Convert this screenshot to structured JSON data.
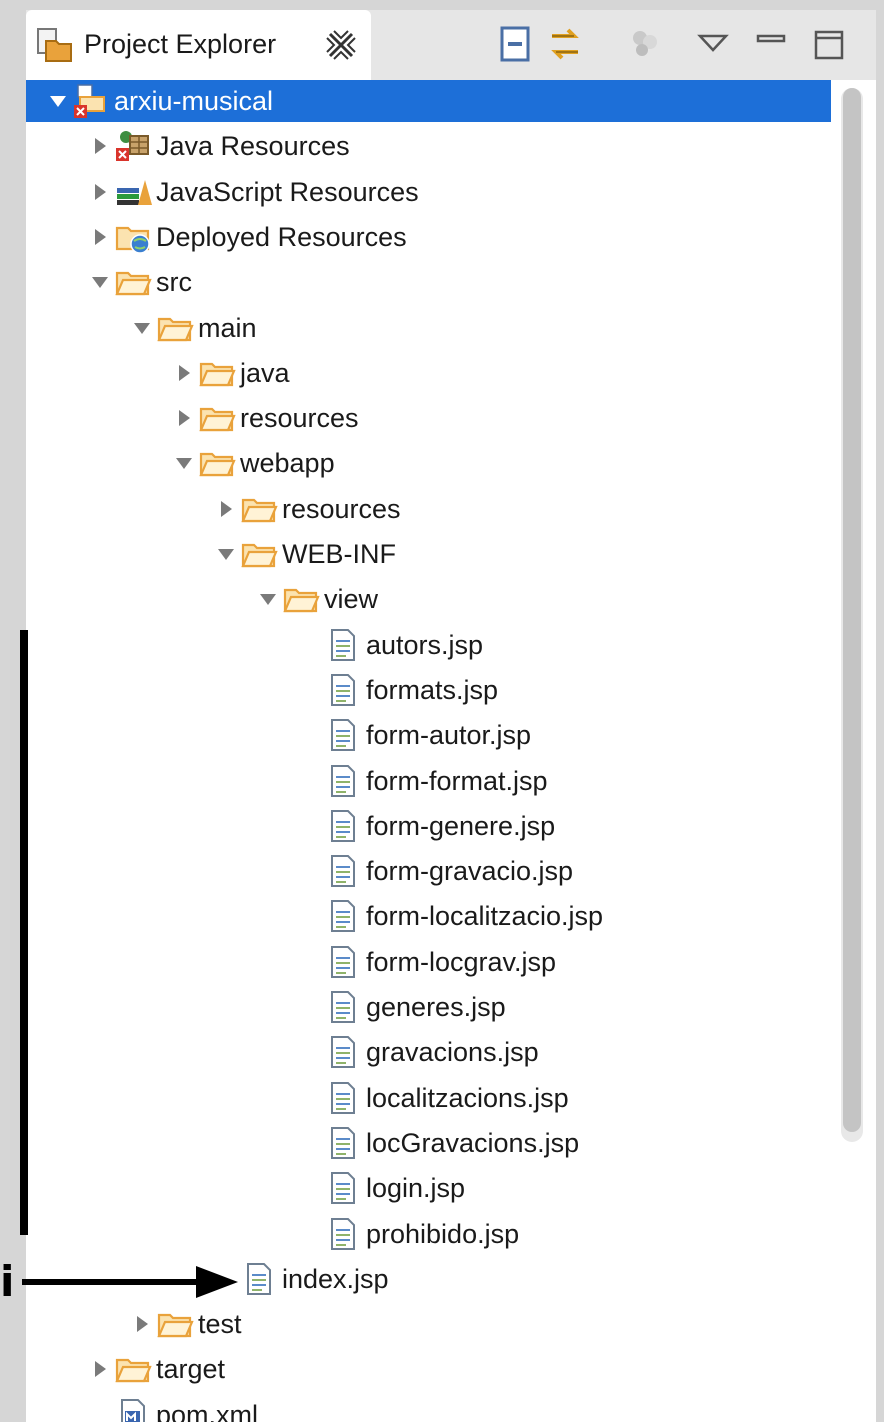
{
  "view": {
    "title": "Project Explorer",
    "close_icon": "close-icon",
    "toolbar": [
      {
        "name": "collapse-all-icon"
      },
      {
        "name": "link-with-editor-icon"
      },
      {
        "name": "filters-icon"
      },
      {
        "name": "view-menu-icon"
      },
      {
        "name": "minimize-icon"
      },
      {
        "name": "maximize-icon"
      }
    ]
  },
  "tree": [
    {
      "label": "arxiu-musical",
      "depth": 0,
      "twisty": "expanded",
      "icon": "project-icon",
      "selected": true
    },
    {
      "label": "Java Resources",
      "depth": 1,
      "twisty": "collapsed",
      "icon": "java-resources-icon"
    },
    {
      "label": "JavaScript Resources",
      "depth": 1,
      "twisty": "collapsed",
      "icon": "javascript-resources-icon"
    },
    {
      "label": "Deployed Resources",
      "depth": 1,
      "twisty": "collapsed",
      "icon": "deployed-resources-icon"
    },
    {
      "label": "src",
      "depth": 1,
      "twisty": "expanded",
      "icon": "folder-icon"
    },
    {
      "label": "main",
      "depth": 2,
      "twisty": "expanded",
      "icon": "folder-icon"
    },
    {
      "label": "java",
      "depth": 3,
      "twisty": "collapsed",
      "icon": "folder-icon"
    },
    {
      "label": "resources",
      "depth": 3,
      "twisty": "collapsed",
      "icon": "folder-icon"
    },
    {
      "label": "webapp",
      "depth": 3,
      "twisty": "expanded",
      "icon": "folder-icon"
    },
    {
      "label": "resources",
      "depth": 4,
      "twisty": "collapsed",
      "icon": "folder-icon"
    },
    {
      "label": "WEB-INF",
      "depth": 4,
      "twisty": "expanded",
      "icon": "folder-icon"
    },
    {
      "label": "view",
      "depth": 5,
      "twisty": "expanded",
      "icon": "folder-icon"
    },
    {
      "label": "autors.jsp",
      "depth": 6,
      "twisty": "none",
      "icon": "jsp-file-icon"
    },
    {
      "label": "formats.jsp",
      "depth": 6,
      "twisty": "none",
      "icon": "jsp-file-icon"
    },
    {
      "label": "form-autor.jsp",
      "depth": 6,
      "twisty": "none",
      "icon": "jsp-file-icon"
    },
    {
      "label": "form-format.jsp",
      "depth": 6,
      "twisty": "none",
      "icon": "jsp-file-icon"
    },
    {
      "label": "form-genere.jsp",
      "depth": 6,
      "twisty": "none",
      "icon": "jsp-file-icon"
    },
    {
      "label": "form-gravacio.jsp",
      "depth": 6,
      "twisty": "none",
      "icon": "jsp-file-icon"
    },
    {
      "label": "form-localitzacio.jsp",
      "depth": 6,
      "twisty": "none",
      "icon": "jsp-file-icon"
    },
    {
      "label": "form-locgrav.jsp",
      "depth": 6,
      "twisty": "none",
      "icon": "jsp-file-icon"
    },
    {
      "label": "generes.jsp",
      "depth": 6,
      "twisty": "none",
      "icon": "jsp-file-icon"
    },
    {
      "label": "gravacions.jsp",
      "depth": 6,
      "twisty": "none",
      "icon": "jsp-file-icon"
    },
    {
      "label": "localitzacions.jsp",
      "depth": 6,
      "twisty": "none",
      "icon": "jsp-file-icon"
    },
    {
      "label": "locGravacions.jsp",
      "depth": 6,
      "twisty": "none",
      "icon": "jsp-file-icon"
    },
    {
      "label": "login.jsp",
      "depth": 6,
      "twisty": "none",
      "icon": "jsp-file-icon"
    },
    {
      "label": "prohibido.jsp",
      "depth": 6,
      "twisty": "none",
      "icon": "jsp-file-icon"
    },
    {
      "label": "index.jsp",
      "depth": 4,
      "twisty": "none",
      "icon": "jsp-file-icon"
    },
    {
      "label": "test",
      "depth": 2,
      "twisty": "collapsed",
      "icon": "folder-icon"
    },
    {
      "label": "target",
      "depth": 1,
      "twisty": "collapsed",
      "icon": "folder-icon"
    },
    {
      "label": "pom.xml",
      "depth": 1,
      "twisty": "none",
      "icon": "maven-pom-icon"
    }
  ],
  "annotation": {
    "letter": "i",
    "color": "#000000"
  },
  "colors": {
    "selection": "#1d6fd8",
    "folder": "#e9a23b",
    "background": "#d6d6d6"
  }
}
